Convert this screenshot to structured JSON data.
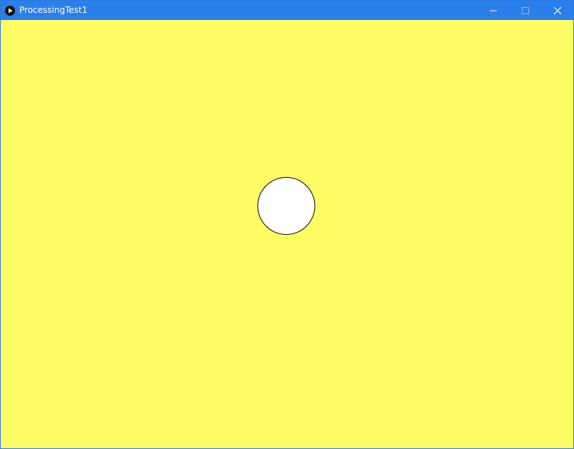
{
  "window": {
    "title": "ProcessingTest1"
  },
  "icons": {
    "app": "processing-play-icon",
    "minimize": "minimize-icon",
    "maximize": "maximize-icon",
    "close": "close-icon"
  },
  "colors": {
    "titlebar": "#2b7fe8",
    "canvas_background": "#fffe66",
    "circle_fill": "#ffffff",
    "circle_stroke": "#000000"
  }
}
